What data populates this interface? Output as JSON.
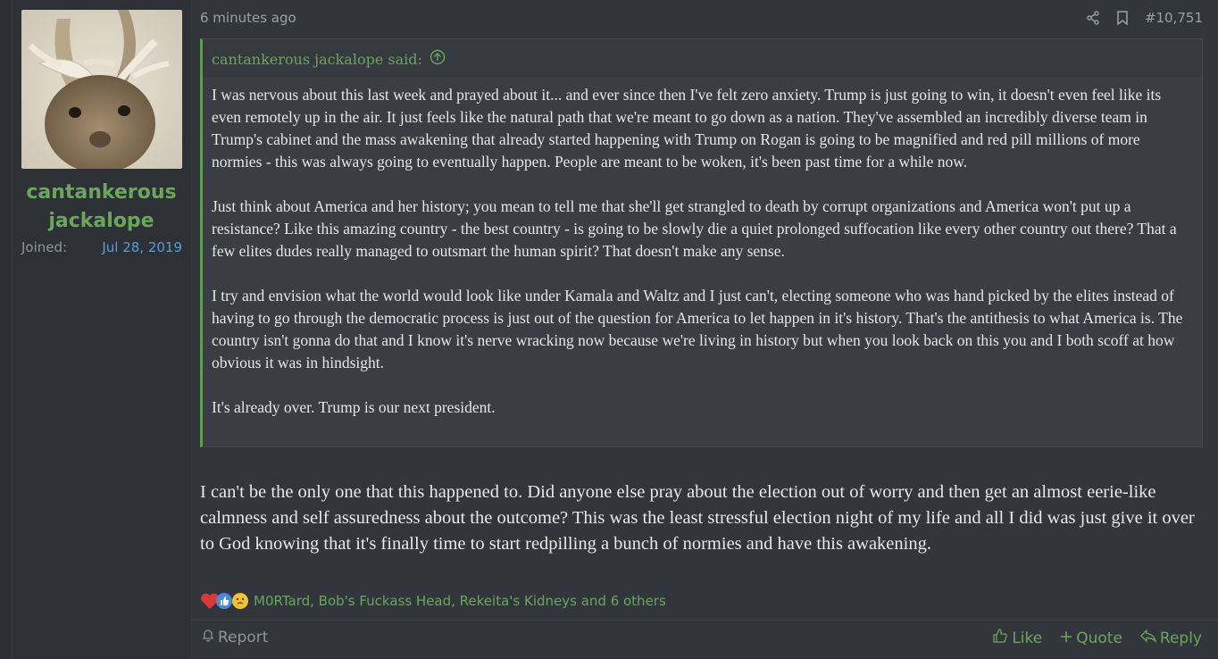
{
  "author": {
    "name": "cantankerous jackalope",
    "joined_label": "Joined:",
    "joined_date": "Jul 28, 2019"
  },
  "post": {
    "timestamp": "6 minutes ago",
    "number": "#10,751"
  },
  "quote": {
    "attribution": "cantankerous jackalope said:",
    "paragraphs": [
      "I was nervous about this last week and prayed about it... and ever since then I've felt zero anxiety. Trump is just going to win, it doesn't even feel like its even remotely up in the air. It just feels like the natural path that we're meant to go down as a nation. They've assembled an incredibly diverse team in Trump's cabinet and the mass awakening that already started happening with Trump on Rogan is going to be magnified and red pill millions of more normies - this was always going to eventually happen. People are meant to be woken, it's been past time for a while now.",
      "Just think about America and her history; you mean to tell me that she'll get strangled to death by corrupt organizations and America won't put up a resistance? Like this amazing country - the best country - is going to be slowly die a quiet prolonged suffocation like every other country out there? That a few elites dudes really managed to outsmart the human spirit? That doesn't make any sense.",
      "I try and envision what the world would look like under Kamala and Waltz and I just can't, electing someone who was hand picked by the elites instead of having to go through the democratic process is just out of the question for America to let happen in it's history. That's the antithesis to what America is. The country isn't gonna do that and I know it's nerve wracking now because we're living in history but when you look back on this you and I both scoff at how obvious it was in hindsight.",
      "It's already over. Trump is our next president."
    ]
  },
  "message": "I can't be the only one that this happened to. Did anyone else pray about the election out of worry and then get an almost eerie-like calmness and self assuredness about the outcome? This was the least stressful election night of my life and all I did was just give it over to God knowing that it's finally time to start redpilling a bunch of normies and have this awakening.",
  "reactions": {
    "icons": [
      "heart-icon",
      "like-icon",
      "thinking-icon"
    ],
    "text": "M0RTard, Bob's Fuckass Head, Rekeita's Kidneys and 6 others"
  },
  "actions": {
    "report": "Report",
    "like": "Like",
    "quote": "Quote",
    "reply": "Reply"
  },
  "colors": {
    "accent_green": "#6aa65c",
    "link_blue": "#5a9bd8",
    "quote_border": "#55a24a"
  }
}
